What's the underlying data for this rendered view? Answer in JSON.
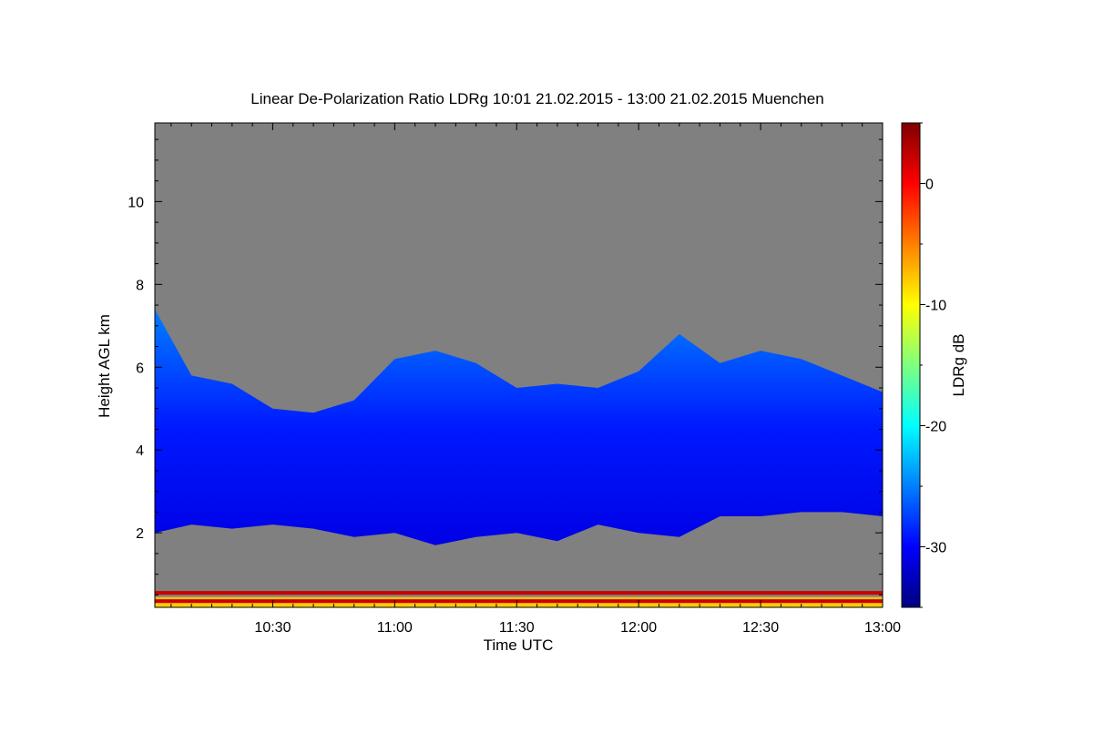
{
  "chart_data": {
    "type": "heatmap",
    "title": "Linear De-Polarization Ratio LDRg   10:01 21.02.2015 - 13:00 21.02.2015 Muenchen",
    "xlabel": "Time UTC",
    "ylabel": "Height AGL km",
    "colorbar_label": "LDRg dB",
    "xlim": [
      "10:01",
      "13:00"
    ],
    "x_ticks": [
      "10:30",
      "11:00",
      "11:30",
      "12:00",
      "12:30",
      "13:00"
    ],
    "ylim": [
      0.2,
      11.9
    ],
    "y_ticks": [
      "2",
      "4",
      "6",
      "8",
      "10"
    ],
    "colorbar_range": [
      -35,
      5
    ],
    "colorbar_ticks": [
      "0",
      "-10",
      "-20",
      "-30"
    ],
    "background_color": "#808080",
    "colormap": [
      "#00007f",
      "#0000ff",
      "#007fff",
      "#00ffff",
      "#7fff7f",
      "#ffff00",
      "#ff7f00",
      "#ff0000",
      "#7f0000"
    ],
    "cloud_layer": {
      "time": [
        "10:01",
        "10:10",
        "10:20",
        "10:30",
        "10:40",
        "10:50",
        "11:00",
        "11:10",
        "11:20",
        "11:30",
        "11:40",
        "11:50",
        "12:00",
        "12:10",
        "12:20",
        "12:30",
        "12:40",
        "12:50",
        "13:00"
      ],
      "base_km": [
        2.0,
        2.2,
        2.1,
        2.2,
        2.1,
        1.9,
        2.0,
        1.7,
        1.9,
        2.0,
        1.8,
        2.2,
        2.0,
        1.9,
        2.4,
        2.4,
        2.5,
        2.5,
        2.4
      ],
      "top_km": [
        7.4,
        5.8,
        5.6,
        5.0,
        4.9,
        5.2,
        6.2,
        6.4,
        6.1,
        5.5,
        5.6,
        5.5,
        5.9,
        6.8,
        6.1,
        6.4,
        6.2,
        5.8,
        5.4
      ],
      "ldr_db": -29
    },
    "surface_layers": [
      {
        "height_km": 0.55,
        "ldr_db": 2
      },
      {
        "height_km": 0.35,
        "ldr_db": 2
      },
      {
        "height_km": 0.25,
        "ldr_db": -8
      }
    ]
  }
}
